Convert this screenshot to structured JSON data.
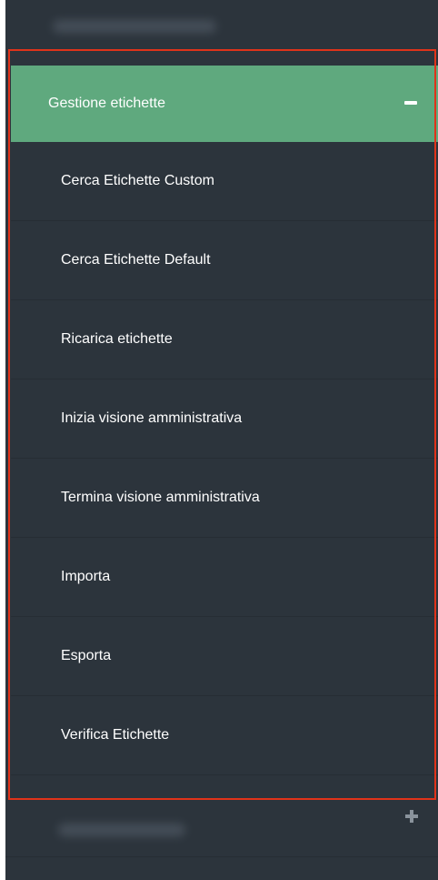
{
  "top_item": {
    "label_obscured": true
  },
  "section": {
    "title": "Gestione etichette",
    "toggle_icon": "minus-icon",
    "expanded": true,
    "items": [
      {
        "label": "Cerca Etichette Custom"
      },
      {
        "label": "Cerca Etichette Default"
      },
      {
        "label": "Ricarica etichette"
      },
      {
        "label": "Inizia visione amministrativa"
      },
      {
        "label": "Termina visione amministrativa"
      },
      {
        "label": "Importa"
      },
      {
        "label": "Esporta"
      },
      {
        "label": "Verifica Etichette"
      }
    ]
  },
  "next_section": {
    "label_obscured": true,
    "toggle_icon": "plus-icon",
    "expanded": false
  },
  "colors": {
    "sidebar_bg": "#2c343c",
    "active_header_bg": "#5fa97e",
    "highlight_border": "#e0331a",
    "text": "#ffffff"
  }
}
